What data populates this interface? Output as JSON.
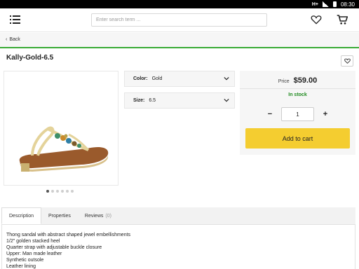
{
  "status_bar": {
    "network": "H+",
    "time": "08:30"
  },
  "header": {
    "search_placeholder": "Enter search term ...",
    "icons": {
      "menu": "hamburger-menu-icon",
      "wishlist": "heart-icon",
      "cart": "cart-icon"
    }
  },
  "nav": {
    "back_label": "Back"
  },
  "product": {
    "title": "Kally-Gold-6.5",
    "image_count": 6,
    "active_image": 1,
    "attributes": [
      {
        "label": "Color:",
        "value": "Gold"
      },
      {
        "label": "Size:",
        "value": "6.5"
      }
    ],
    "price_label": "Price",
    "price": "$59.00",
    "stock": "In stock",
    "quantity": "1",
    "minus_label": "−",
    "plus_label": "+",
    "add_to_cart_label": "Add to cart"
  },
  "tabs": [
    {
      "label": "Description",
      "count": ""
    },
    {
      "label": "Properties",
      "count": ""
    },
    {
      "label": "Reviews",
      "count": "(0)"
    }
  ],
  "description_lines": [
    "Thong sandal with abstract shaped jewel embellishments",
    "1/2\" golden stacked heel",
    "Quarter strap with adjustable buckle closure",
    "Upper: Man made leather",
    "Synthetic outsole",
    "Leather lining"
  ],
  "colors": {
    "accent_green": "#3aaa35",
    "cart_yellow": "#f4cd30",
    "stock_green": "#1e8a1e"
  }
}
